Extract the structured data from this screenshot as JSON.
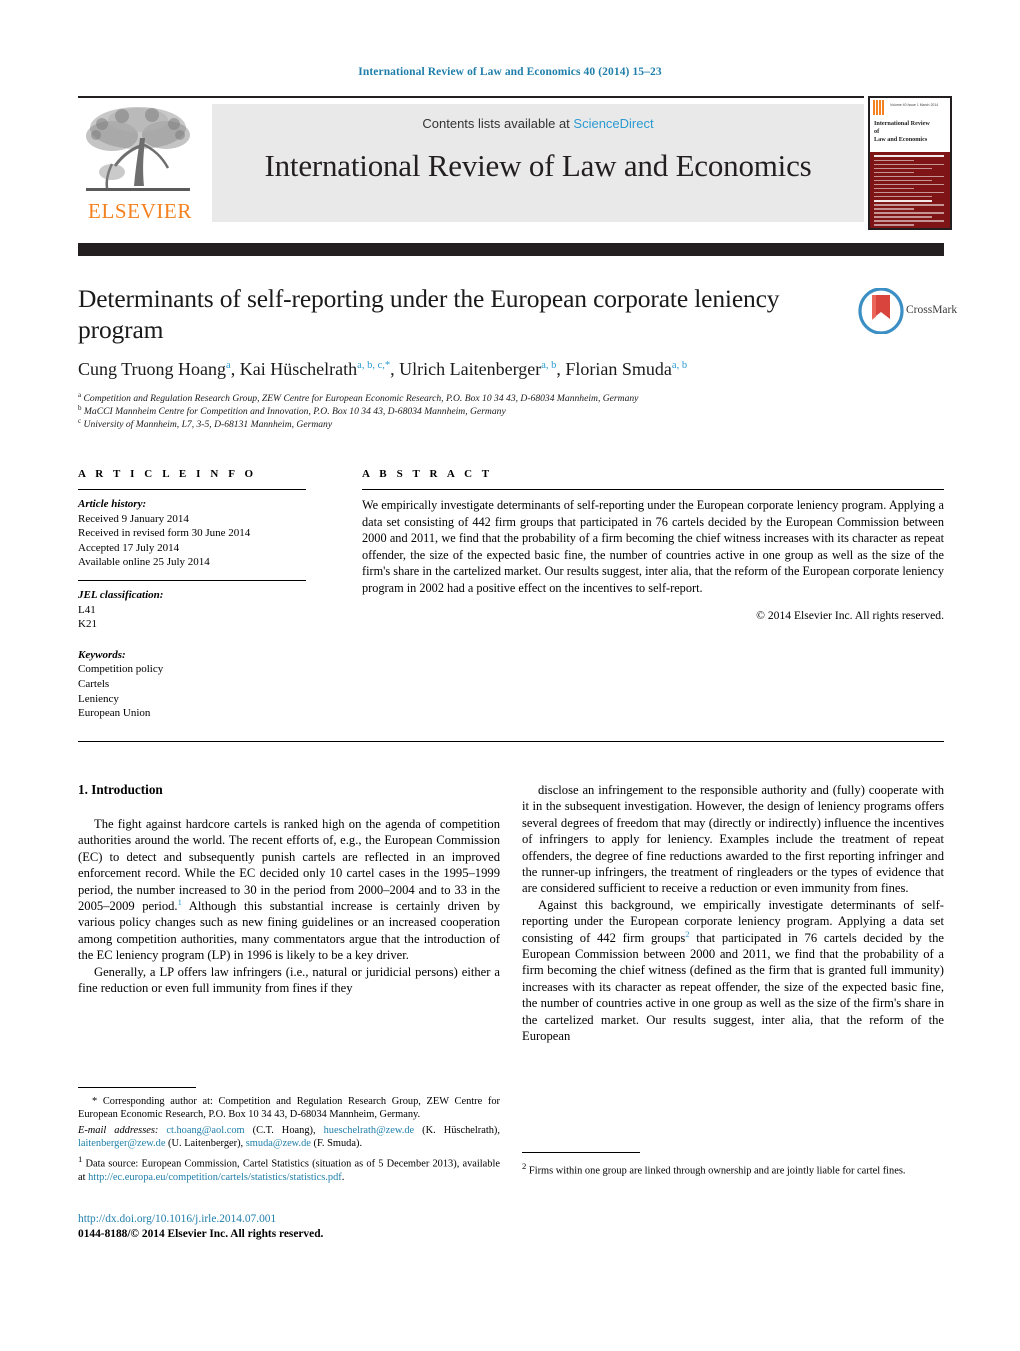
{
  "running_head": "International Review of Law and Economics 40 (2014) 15–23",
  "masthead": {
    "publisher_logo_label": "ELSEVIER",
    "contents_prefix": "Contents lists available at ",
    "contents_link": "ScienceDirect",
    "journal_title": "International Review of Law and Economics",
    "cover": {
      "volume_text": "Volume 40 Issue 1 March 2014",
      "title_line1": "International Review",
      "title_line2": "of",
      "title_line3": "Law and Economics",
      "editor_label": "Editors"
    }
  },
  "article": {
    "title": "Determinants of self-reporting under the European corporate leniency program",
    "authors_html": "Cung Truong Hoang<sup>a</sup>, Kai Hüschelrath<sup>a, b, c,</sup><sup>*</sup>, Ulrich Laitenberger<sup>a, b</sup>, Florian Smuda<sup>a, b</sup>",
    "affiliations": [
      {
        "marker": "a",
        "text": "Competition and Regulation Research Group, ZEW Centre for European Economic Research, P.O. Box 10 34 43, D-68034 Mannheim, Germany"
      },
      {
        "marker": "b",
        "text": "MaCCI Mannheim Centre for Competition and Innovation, P.O. Box 10 34 43, D-68034 Mannheim, Germany"
      },
      {
        "marker": "c",
        "text": "University of Mannheim, L7, 3-5, D-68131 Mannheim, Germany"
      }
    ],
    "crossmark_label": "CrossMark"
  },
  "info": {
    "heading": "A R T I C L E    I N F O",
    "history_title": "Article history:",
    "history": [
      "Received 9 January 2014",
      "Received in revised form 30 June 2014",
      "Accepted 17 July 2014",
      "Available online 25 July 2014"
    ],
    "jel_title": "JEL classification:",
    "jel": [
      "L41",
      "K21"
    ],
    "keywords_title": "Keywords:",
    "keywords": [
      "Competition policy",
      "Cartels",
      "Leniency",
      "European Union"
    ]
  },
  "abstract": {
    "heading": "A B S T R A C T",
    "text": "We empirically investigate determinants of self-reporting under the European corporate leniency program. Applying a data set consisting of 442 firm groups that participated in 76 cartels decided by the European Commission between 2000 and 2011, we find that the probability of a firm becoming the chief witness increases with its character as repeat offender, the size of the expected basic fine, the number of countries active in one group as well as the size of the firm's share in the cartelized market. Our results suggest, inter alia, that the reform of the European corporate leniency program in 2002 had a positive effect on the incentives to self-report.",
    "copyright": "© 2014 Elsevier Inc. All rights reserved."
  },
  "body": {
    "section_heading": "1. Introduction",
    "left_paragraphs": [
      "The fight against hardcore cartels is ranked high on the agenda of competition authorities around the world. The recent efforts of, e.g., the European Commission (EC) to detect and subsequently punish cartels are reflected in an improved enforcement record. While the EC decided only 10 cartel cases in the 1995–1999 period, the number increased to 30 in the period from 2000–2004 and to 33 in the 2005–2009 period.<sup>1</sup> Although this substantial increase is certainly driven by various policy changes such as new fining guidelines or an increased cooperation among competition authorities, many commentators argue that the introduction of the EC leniency program (LP) in 1996 is likely to be a key driver.",
      "Generally, a LP offers law infringers (i.e., natural or juridicial persons) either a fine reduction or even full immunity from fines if they"
    ],
    "right_paragraphs": [
      "disclose an infringement to the responsible authority and (fully) cooperate with it in the subsequent investigation. However, the design of leniency programs offers several degrees of freedom that may (directly or indirectly) influence the incentives of infringers to apply for leniency. Examples include the treatment of repeat offenders, the degree of fine reductions awarded to the first reporting infringer and the runner-up infringers, the treatment of ringleaders or the types of evidence that are considered sufficient to receive a reduction or even immunity from fines.",
      "Against this background, we empirically investigate determinants of self-reporting under the European corporate leniency program. Applying a data set consisting of 442 firm groups<sup>2</sup> that participated in 76 cartels decided by the European Commission between 2000 and 2011, we find that the probability of a firm becoming the chief witness (defined as the firm that is granted full immunity) increases with its character as repeat offender, the size of the expected basic fine, the number of countries active in one group as well as the size of the firm's share in the cartelized market. Our results suggest, inter alia, that the reform of the European"
    ]
  },
  "footnotes": {
    "corresponding_html": "<span class=\"ind\">* Corresponding author at: Competition and Regulation Research Group, ZEW Centre for European Economic Research, P.O. Box 10 34 43, D-68034 Mannheim, Germany.",
    "emails_html": "<i>E-mail addresses:</i> <span class=\"link\">ct.hoang@aol.com</span> (C.T. Hoang), <span class=\"link\">hueschelrath@zew.de</span> (K. Hüschelrath), <span class=\"link\">laitenberger@zew.de</span> (U. Laitenberger), <span class=\"link\">smuda@zew.de</span> (F. Smuda).",
    "note1_html": "<sup>1</sup> Data source: European Commission, Cartel Statistics (situation as of 5 December 2013), available at <span class=\"link\">http://ec.europa.eu/competition/cartels/statistics/statistics.pdf</span>.",
    "note2_html": "<sup>2</sup> Firms within one group are linked through ownership and are jointly liable for cartel fines."
  },
  "footer": {
    "doi": "http://dx.doi.org/10.1016/j.irle.2014.07.001",
    "issn": "0144-8188/© 2014 Elsevier Inc. All rights reserved."
  },
  "colors": {
    "link_blue": "#1f7faa",
    "sciencedirect_blue": "#2b9ad1",
    "elsevier_orange": "#f58220",
    "rule_black": "#231f20",
    "cover_red": "#7e1416"
  }
}
